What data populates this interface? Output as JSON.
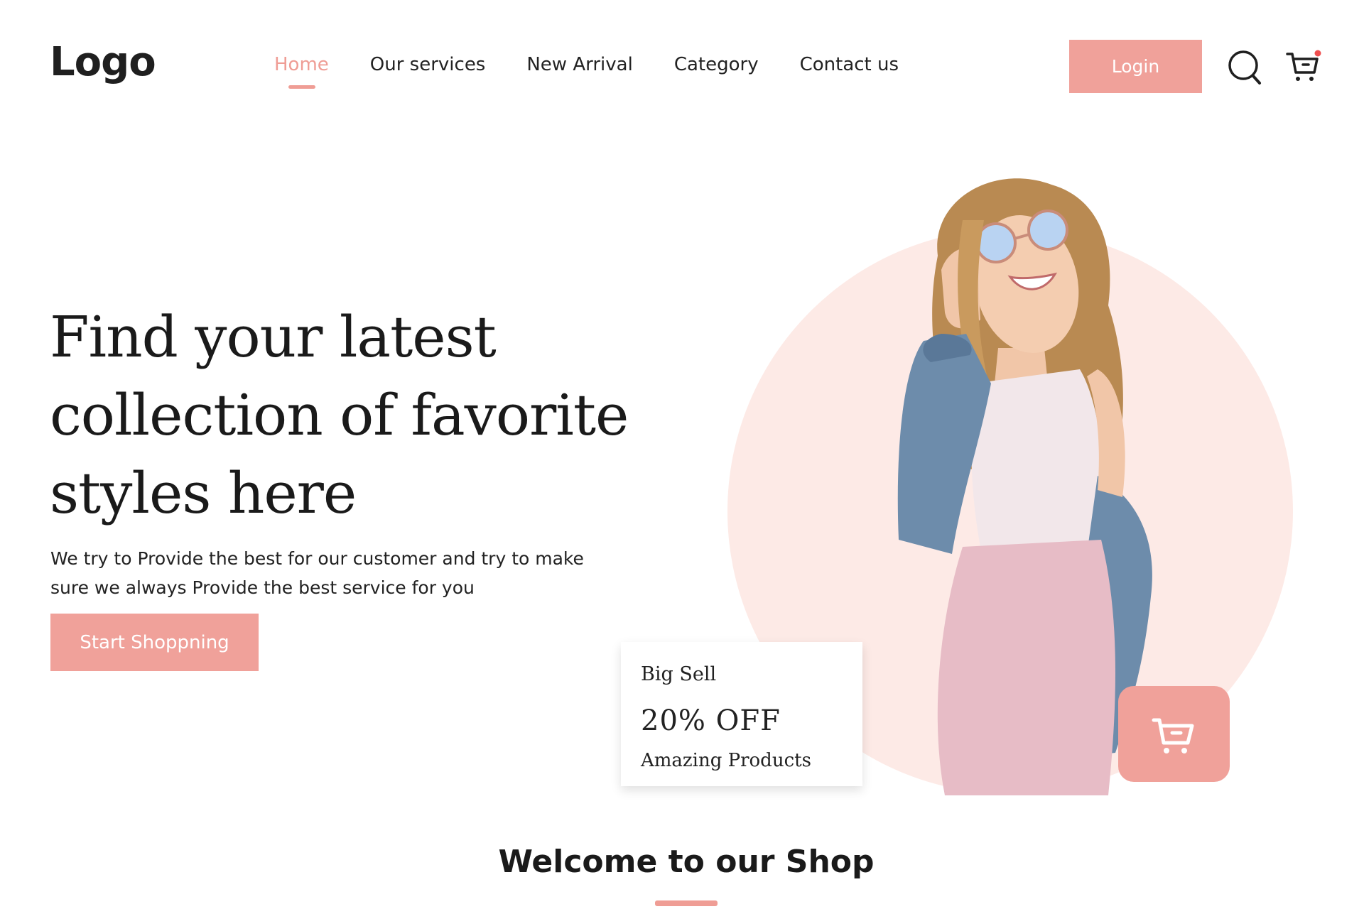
{
  "header": {
    "logo": "Logo",
    "nav": [
      {
        "label": "Home",
        "active": true
      },
      {
        "label": "Our services"
      },
      {
        "label": "New Arrival"
      },
      {
        "label": "Category"
      },
      {
        "label": "Contact us"
      }
    ],
    "login_label": "Login",
    "icons": {
      "search": "search-icon",
      "cart": "cart-icon"
    }
  },
  "hero": {
    "title": "Find your latest collection of favorite styles here",
    "subtitle": "We try to Provide the best for our customer and try to make sure we always Provide the best service for you",
    "cta_label": "Start Shoppning"
  },
  "promo": {
    "line1": "Big Sell",
    "line2": "20% OFF",
    "line3": "Amazing Products"
  },
  "welcome": {
    "title": "Welcome to our Shop"
  },
  "colors": {
    "accent": "#f0a19a",
    "circle_bg": "#fdeae6",
    "text": "#1f1f1f"
  }
}
